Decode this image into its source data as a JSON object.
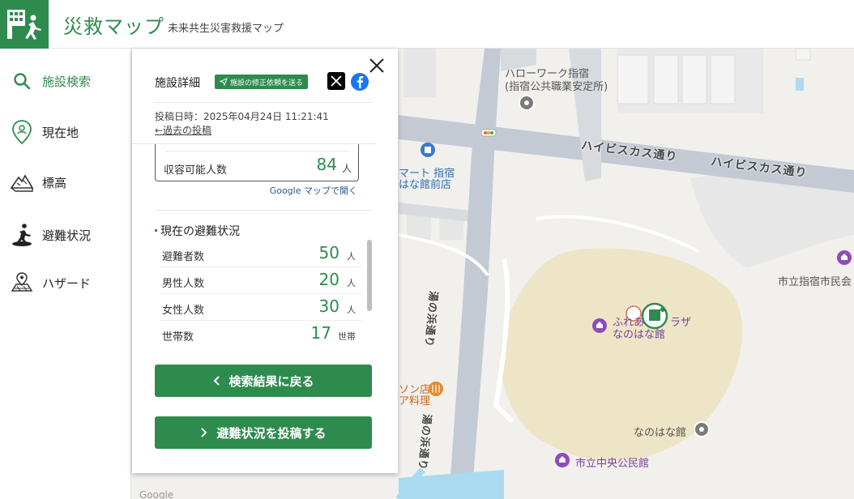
{
  "header": {
    "title": "災救マップ",
    "subtitle": "未来共生災害救援マップ",
    "logo_icon": "evacuation-building-icon",
    "brand_color": "#2e8b4e"
  },
  "sidebar": {
    "items": [
      {
        "label": "施設検索",
        "icon": "search-icon",
        "active": true
      },
      {
        "label": "現在地",
        "icon": "location-pin-icon",
        "active": false
      },
      {
        "label": "標高",
        "icon": "elevation-icon",
        "active": false
      },
      {
        "label": "避難状況",
        "icon": "evacuation-status-icon",
        "active": false
      },
      {
        "label": "ハザード",
        "icon": "hazard-map-icon",
        "active": false
      }
    ]
  },
  "panel": {
    "title": "施設詳細",
    "fix_request_label": "施設の修正依頼を送る",
    "post_time": "投稿日時：2025年04月24日 11:21:41",
    "past_posts_link": "←過去の投稿",
    "capacity": {
      "label": "収容可能人数",
      "value": "84",
      "unit": "人"
    },
    "google_maps_link": "Google マップで開く",
    "status_section_title": "現在の避難状況",
    "stats": [
      {
        "label": "避難者数",
        "value": "50",
        "unit": "人"
      },
      {
        "label": "男性人数",
        "value": "20",
        "unit": "人"
      },
      {
        "label": "女性人数",
        "value": "30",
        "unit": "人"
      },
      {
        "label": "世帯数",
        "value": "17",
        "unit": "世帯"
      }
    ],
    "back_button": "検索結果に戻る",
    "post_button": "避難状況を投稿する"
  },
  "map": {
    "labels": {
      "hellowork_1": "ハローワーク指宿",
      "hellowork_2": "(指宿公共職業安定所)",
      "road_hibiscus_1": "ハイビスカス通り",
      "road_hibiscus_2": "ハイビスカス通り",
      "mart_1": "マート 指宿",
      "mart_2": "はな館前店",
      "shimin_kaikan": "市立指宿市民会",
      "fureai_1": "ふれあ",
      "fureai_2": "ラザ",
      "fureai_3": "なのはな館",
      "restaurant_1": "ソン店",
      "restaurant_2": "ア料理",
      "nanohana": "なのはな館",
      "chuo_kominkan": "市立中央公民館",
      "road_vertical_1": "湯の浜通り",
      "road_vertical_2": "湯の浜通り",
      "google": "Google"
    }
  }
}
